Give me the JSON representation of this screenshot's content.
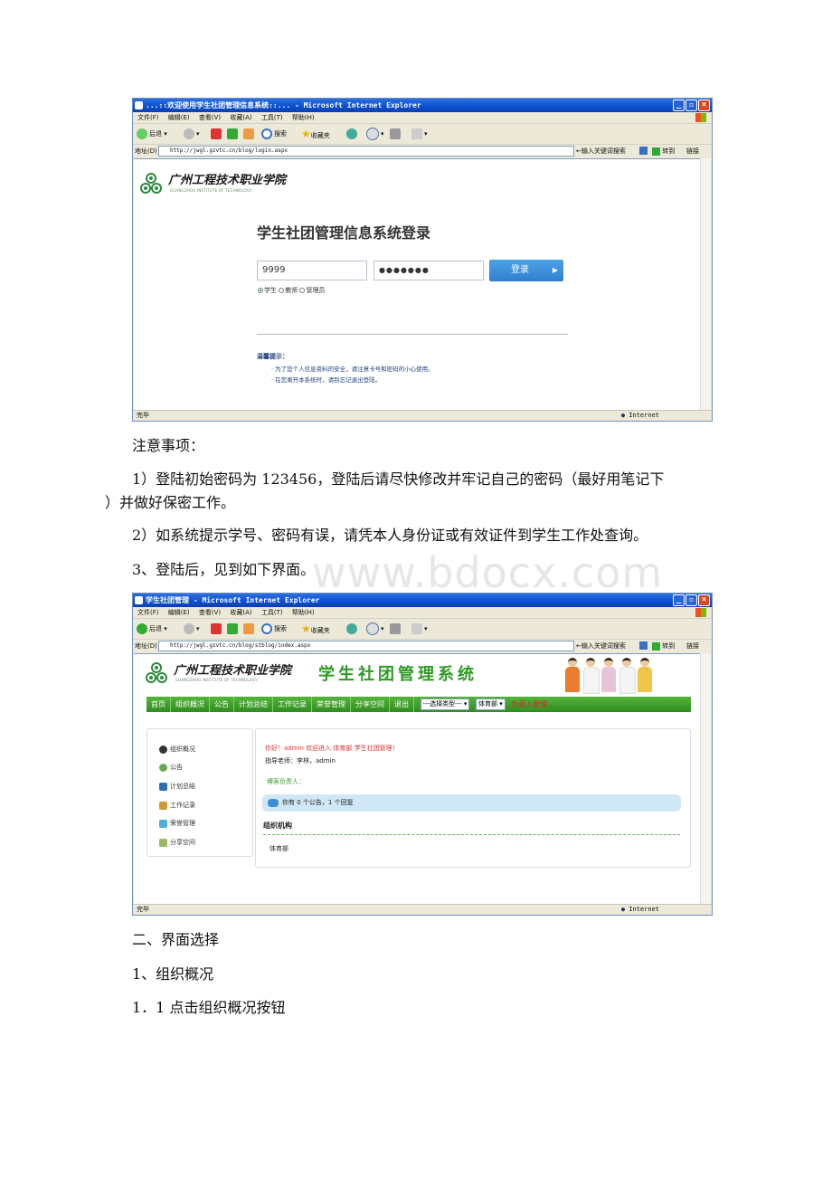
{
  "screenshot1": {
    "window_title": "...::欢迎使用学生社团管理信息系统::... - Microsoft Internet Explorer",
    "menu": [
      "文件(F)",
      "编辑(E)",
      "查看(V)",
      "收藏(A)",
      "工具(T)",
      "帮助(H)"
    ],
    "toolbar": {
      "back": "后退",
      "search": "搜索",
      "favorites": "收藏夹"
    },
    "address_label": "地址(D)",
    "address": "http://jwgl.gzvtc.cn/blog/login.aspx",
    "search_hint": "←输入关键词搜索",
    "go": "转到",
    "links": "链接",
    "logo_cn": "广州工程技术职业学院",
    "logo_en": "GUANGZHOU INSTITUTE OF TECHNOLOGY",
    "login_title": "学生社团管理信息系统登录",
    "username": "9999",
    "password_mask": "●●●●●●●",
    "login_button": "登录",
    "roles": [
      "学生",
      "教师",
      "管理员"
    ],
    "tips_title": "温馨提示：",
    "tips": [
      "· 为了您个人信息资料的安全，请注意卡号和密码的小心使用。",
      "· 在您离开本系统时，请别忘记退出登陆。"
    ],
    "status": "完毕",
    "zone": "Internet"
  },
  "doc": {
    "p1": "注意事项：",
    "p2a": "1）登陆初始密码为 123456，登陆后请尽快修改并牢记自己的密码（最好用笔记下",
    "p2b": "）并做好保密工作。",
    "p3": "2）如系统提示学号、密码有误，请凭本人身份证或有效证件到学生工作处查询。",
    "p4": "3、登陆后，见到如下界面。",
    "watermark": "www.bdocx.com",
    "p5": "二、界面选择",
    "p6": "1、组织概况",
    "p7": "1．1 点击组织概况按钮"
  },
  "screenshot2": {
    "window_title": "学生社团管理 - Microsoft Internet Explorer",
    "address": "http://jwgl.gzvtc.cn/blog/stblog/index.aspx",
    "system_title": "学生社团管理系统",
    "nav": [
      "首页",
      "组织概况",
      "公告",
      "计划总结",
      "工作记录",
      "荣誉管理",
      "分享空间",
      "退出"
    ],
    "type_select": "---选择类型---",
    "dept_select": "体育部",
    "nav_red": "负责人管理",
    "side": [
      "组织概况",
      "公告",
      "计划总结",
      "工作记录",
      "荣誉管理",
      "分享空间"
    ],
    "welcome": "你好！admin  欢迎进入  体育部  学生社团管理！",
    "advisor": "指导老师：李林，admin",
    "blog_owner": "博客负责人：",
    "notice": "你有  0 个公告，1 个回复",
    "org_title": "组织机构",
    "org_item": "体育部",
    "status": "完毕",
    "zone": "Internet"
  },
  "colors": {
    "green": "#2e9b24",
    "blue": "#2f7fcf",
    "xp_title": "#0a4fd0"
  },
  "icons": [
    "back-icon",
    "forward-icon",
    "stop-icon",
    "refresh-icon",
    "home-icon",
    "search-icon",
    "favorites-star-icon",
    "history-icon",
    "mail-icon",
    "print-icon",
    "ie-page-icon",
    "internet-globe-icon",
    "go-arrow-icon"
  ]
}
